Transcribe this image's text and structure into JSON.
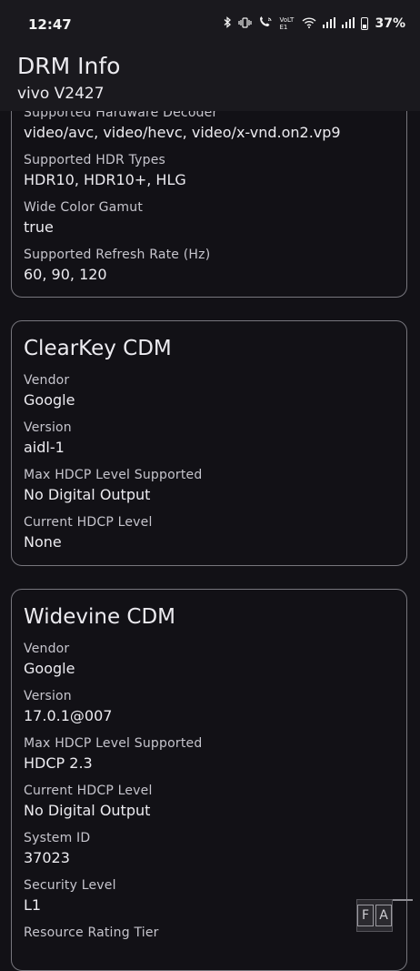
{
  "status_bar": {
    "time": "12:47",
    "icons": [
      "bluetooth-icon",
      "vibrate-icon",
      "wifi-calling-icon",
      "volte-icon",
      "wifi-icon",
      "signal-icon",
      "signal-icon",
      "battery-icon"
    ],
    "volte_text": "VoLTE1",
    "battery_percent": "37%"
  },
  "app_bar": {
    "title": "DRM Info",
    "subtitle": "vivo V2427"
  },
  "display_card": {
    "fields": [
      {
        "label": "Supported Hardware Decoder",
        "value": "video/avc, video/hevc, video/x-vnd.on2.vp9"
      },
      {
        "label": "Supported HDR Types",
        "value": "HDR10, HDR10+, HLG"
      },
      {
        "label": "Wide Color Gamut",
        "value": "true"
      },
      {
        "label": "Supported Refresh Rate (Hz)",
        "value": "60, 90, 120"
      }
    ]
  },
  "clearkey_card": {
    "title": "ClearKey CDM",
    "fields": [
      {
        "label": "Vendor",
        "value": "Google"
      },
      {
        "label": "Version",
        "value": "aidl-1"
      },
      {
        "label": "Max HDCP Level Supported",
        "value": "No Digital Output"
      },
      {
        "label": "Current HDCP Level",
        "value": "None"
      }
    ]
  },
  "widevine_card": {
    "title": "Widevine CDM",
    "fields": [
      {
        "label": "Vendor",
        "value": "Google"
      },
      {
        "label": "Version",
        "value": "17.0.1@007"
      },
      {
        "label": "Max HDCP Level Supported",
        "value": "HDCP 2.3"
      },
      {
        "label": "Current HDCP Level",
        "value": "No Digital Output"
      },
      {
        "label": "System ID",
        "value": "37023"
      },
      {
        "label": "Security Level",
        "value": "L1"
      },
      {
        "label": "Resource Rating Tier",
        "value": ""
      }
    ]
  },
  "overlay_button": {
    "letters": [
      "F",
      "A"
    ]
  }
}
